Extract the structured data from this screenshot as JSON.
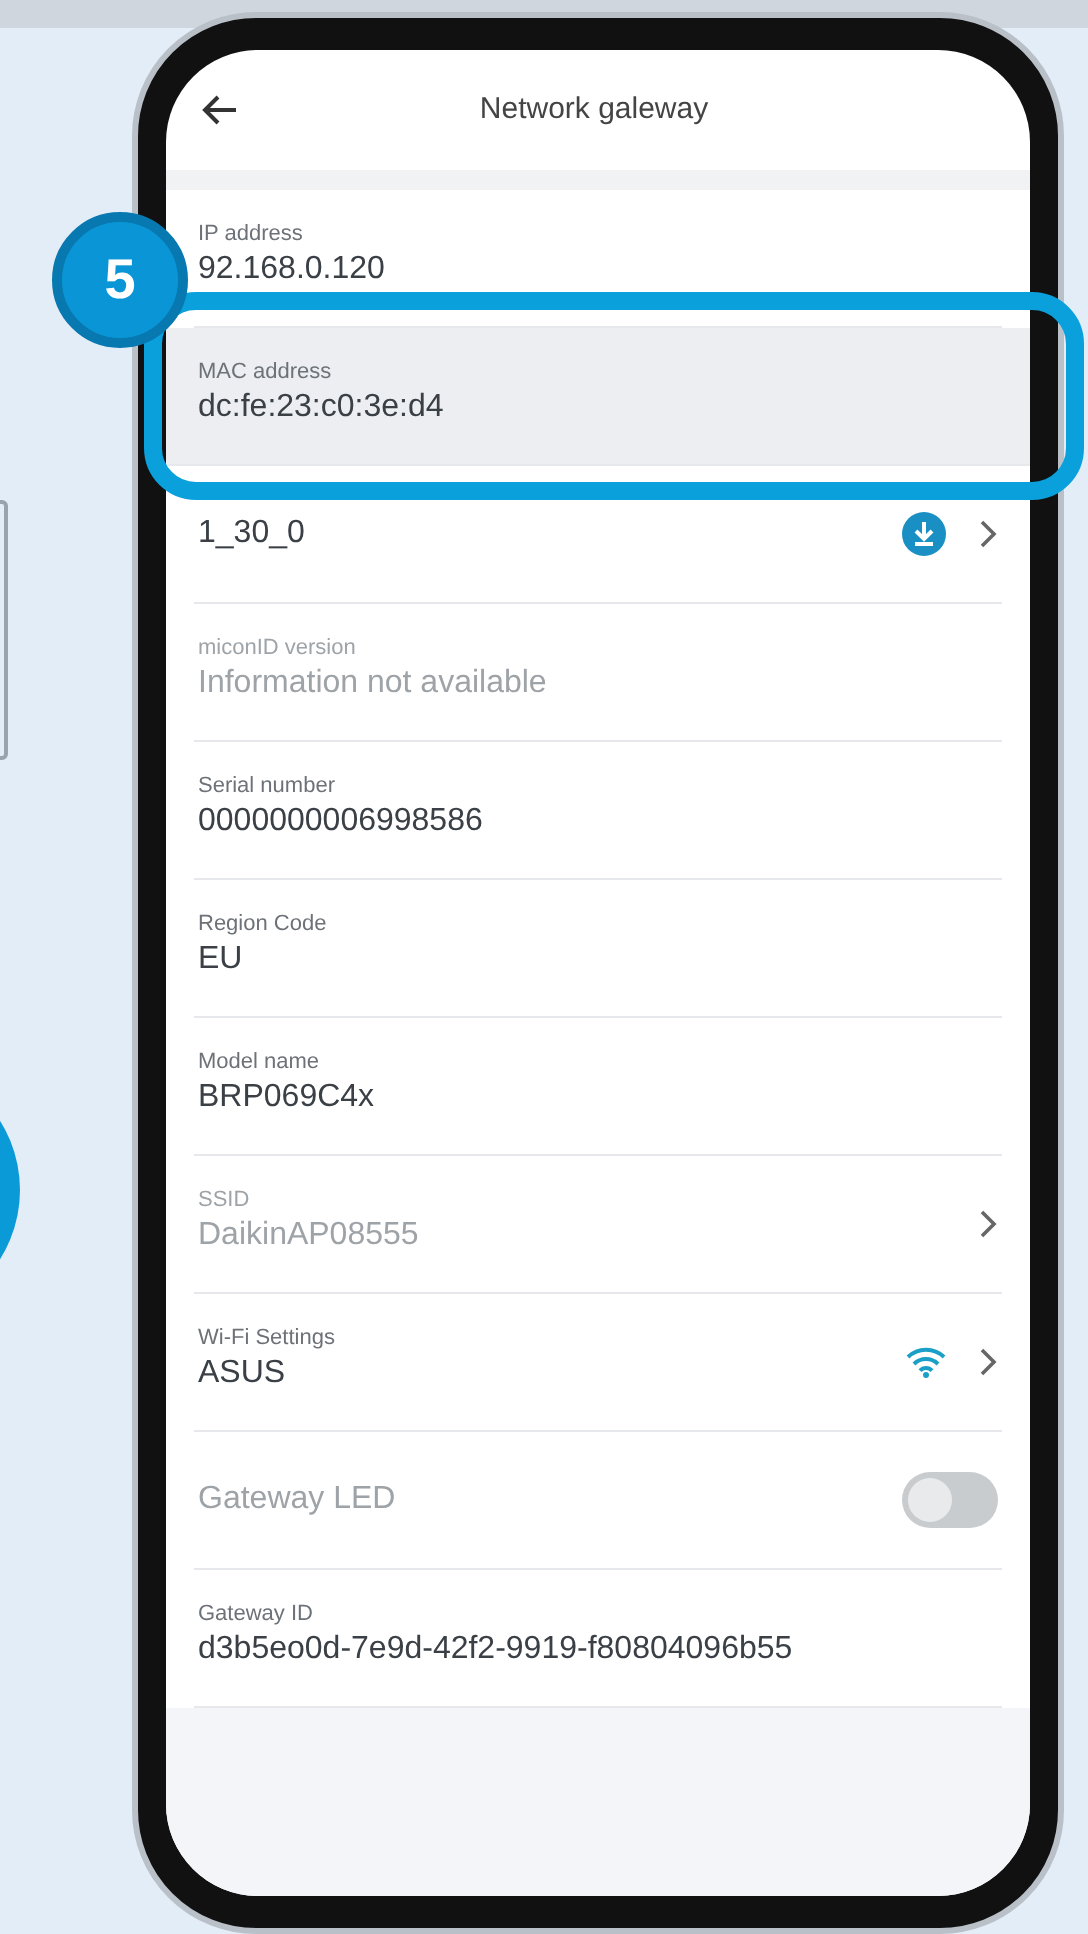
{
  "header": {
    "title": "Network galeway"
  },
  "callout": {
    "number": "5"
  },
  "rows": [
    {
      "kind": "info",
      "label": "IP address",
      "value": "92.168.0.120",
      "disabled": false,
      "highlighted": false
    },
    {
      "kind": "info",
      "label": "MAC address",
      "value": "dc:fe:23:c0:3e:d4",
      "disabled": false,
      "highlighted": true
    },
    {
      "kind": "update",
      "value": "1_30_0",
      "disabled": false,
      "highlighted": false
    },
    {
      "kind": "info",
      "label": "miconID version",
      "value": "Information not available",
      "disabled": true,
      "highlighted": false
    },
    {
      "kind": "info",
      "label": "Serial number",
      "value": "0000000006998586",
      "disabled": false,
      "highlighted": false
    },
    {
      "kind": "info",
      "label": "Region Code",
      "value": "EU",
      "disabled": false,
      "highlighted": false
    },
    {
      "kind": "info",
      "label": "Model name",
      "value": "BRP069C4x",
      "disabled": false,
      "highlighted": false
    },
    {
      "kind": "link",
      "label": "SSID",
      "value": "DaikinAP08555",
      "disabled": true,
      "highlighted": false
    },
    {
      "kind": "wifi",
      "label": "Wi-Fi Settings",
      "value": "ASUS",
      "disabled": false,
      "highlighted": false
    },
    {
      "kind": "toggle",
      "value": "Gateway LED",
      "on": false,
      "disabled": true,
      "highlighted": false
    },
    {
      "kind": "info",
      "label": "Gateway ID",
      "value": "d3b5eo0d-7e9d-42f2-9919-f80804096b55",
      "disabled": false,
      "highlighted": false
    }
  ]
}
